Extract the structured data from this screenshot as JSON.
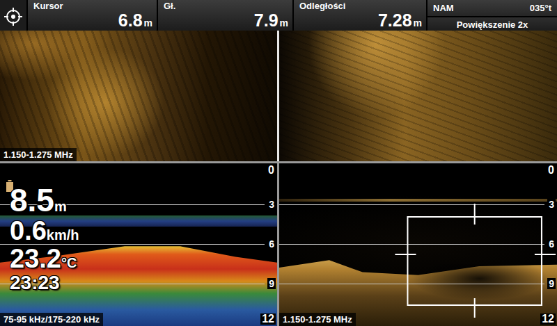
{
  "status_bar": {
    "fields": [
      {
        "label": "Kursor",
        "value": "6.8",
        "unit": "m"
      },
      {
        "label": "Gł.",
        "value": "7.9",
        "unit": "m"
      },
      {
        "label": "Odległości",
        "value": "7.28",
        "unit": "m"
      }
    ],
    "heading": {
      "label": "NAM",
      "value": "035°t"
    },
    "zoom": "Powiększenie 2x"
  },
  "side_imaging": {
    "frequency": "1.150-1.275 MHz"
  },
  "sonar_2d": {
    "depth": {
      "value": "8.5",
      "unit": "m"
    },
    "speed": {
      "value": "0.6",
      "unit": "km/h"
    },
    "temperature": {
      "value": "23.2",
      "unit": "°C"
    },
    "time": "23:23",
    "frequency": "75-95 kHz/175-220 kHz",
    "scale": {
      "ticks": [
        "0",
        "3",
        "6",
        "9",
        "12"
      ]
    }
  },
  "down_imaging": {
    "frequency": "1.150-1.275 MHz",
    "scale": {
      "ticks": [
        "0",
        "3",
        "6",
        "9",
        "12"
      ]
    }
  }
}
